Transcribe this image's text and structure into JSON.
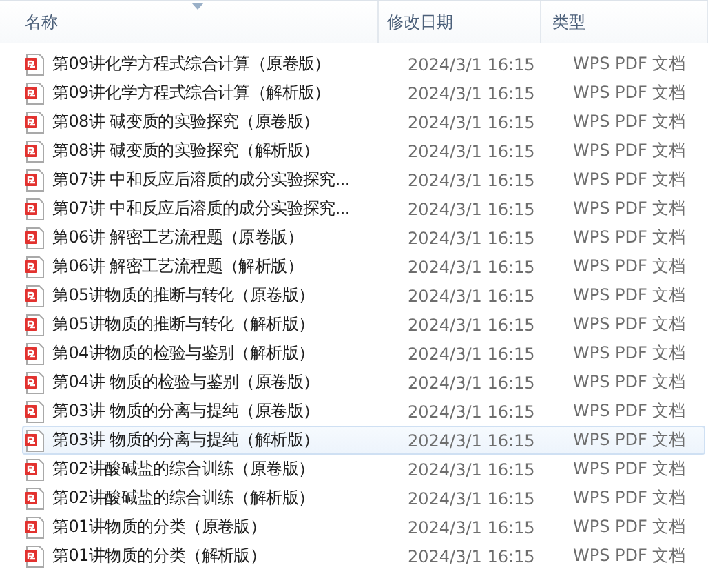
{
  "columns": [
    "名称",
    "修改日期",
    "类型"
  ],
  "rows": [
    {
      "name": "第09讲化学方程式综合计算（原卷版）",
      "date": "2024/3/1 16:15",
      "type": "WPS PDF 文档",
      "selected": false
    },
    {
      "name": "第09讲化学方程式综合计算（解析版）",
      "date": "2024/3/1 16:15",
      "type": "WPS PDF 文档",
      "selected": false
    },
    {
      "name": "第08讲  碱变质的实验探究（原卷版）",
      "date": "2024/3/1 16:15",
      "type": "WPS PDF 文档",
      "selected": false
    },
    {
      "name": "第08讲  碱变质的实验探究（解析版）",
      "date": "2024/3/1 16:15",
      "type": "WPS PDF 文档",
      "selected": false
    },
    {
      "name": "第07讲  中和反应后溶质的成分实验探究...",
      "date": "2024/3/1 16:15",
      "type": "WPS PDF 文档",
      "selected": false
    },
    {
      "name": "第07讲  中和反应后溶质的成分实验探究...",
      "date": "2024/3/1 16:15",
      "type": "WPS PDF 文档",
      "selected": false
    },
    {
      "name": "第06讲  解密工艺流程题（原卷版）",
      "date": "2024/3/1 16:15",
      "type": "WPS PDF 文档",
      "selected": false
    },
    {
      "name": "第06讲  解密工艺流程题（解析版）",
      "date": "2024/3/1 16:15",
      "type": "WPS PDF 文档",
      "selected": false
    },
    {
      "name": "第05讲物质的推断与转化（原卷版）",
      "date": "2024/3/1 16:15",
      "type": "WPS PDF 文档",
      "selected": false
    },
    {
      "name": "第05讲物质的推断与转化（解析版）",
      "date": "2024/3/1 16:15",
      "type": "WPS PDF 文档",
      "selected": false
    },
    {
      "name": "第04讲物质的检验与鉴别（解析版）",
      "date": "2024/3/1 16:15",
      "type": "WPS PDF 文档",
      "selected": false
    },
    {
      "name": "第04讲  物质的检验与鉴别（原卷版）",
      "date": "2024/3/1 16:15",
      "type": "WPS PDF 文档",
      "selected": false
    },
    {
      "name": "第03讲  物质的分离与提纯（原卷版）",
      "date": "2024/3/1 16:15",
      "type": "WPS PDF 文档",
      "selected": false
    },
    {
      "name": "第03讲  物质的分离与提纯（解析版）",
      "date": "2024/3/1 16:15",
      "type": "WPS PDF 文档",
      "selected": true
    },
    {
      "name": "第02讲酸碱盐的综合训练（原卷版）",
      "date": "2024/3/1 16:15",
      "type": "WPS PDF 文档",
      "selected": false
    },
    {
      "name": "第02讲酸碱盐的综合训练（解析版）",
      "date": "2024/3/1 16:15",
      "type": "WPS PDF 文档",
      "selected": false
    },
    {
      "name": "第01讲物质的分类（原卷版）",
      "date": "2024/3/1 16:15",
      "type": "WPS PDF 文档",
      "selected": false
    },
    {
      "name": "第01讲物质的分类（解析版）",
      "date": "2024/3/1 16:15",
      "type": "WPS PDF 文档",
      "selected": false
    }
  ]
}
